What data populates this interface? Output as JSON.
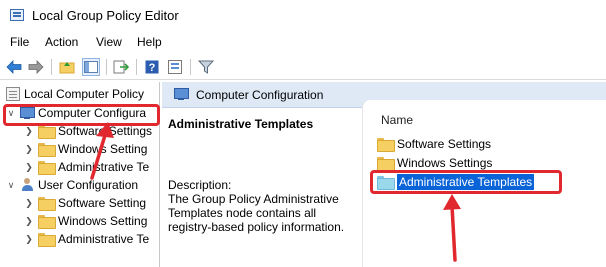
{
  "window": {
    "title": "Local Group Policy Editor",
    "icon": "policy-editor-icon"
  },
  "menu": {
    "items": [
      "File",
      "Action",
      "View",
      "Help"
    ]
  },
  "toolbar": {
    "buttons": [
      "back-arrow-icon",
      "forward-arrow-icon",
      "up-folder-icon",
      "show-hide-tree-icon",
      "export-list-icon",
      "help-icon",
      "properties-icon",
      "filter-icon"
    ]
  },
  "tree": {
    "root": "Local Computer Policy",
    "computer_config": "Computer Configura",
    "computer_children": [
      "Software Settings",
      "Windows Setting",
      "Administrative Te"
    ],
    "user_config": "User Configuration",
    "user_children": [
      "Software Setting",
      "Windows Setting",
      "Administrative Te"
    ]
  },
  "right": {
    "header": "Computer Configuration",
    "extended_title": "Administrative Templates",
    "description_label": "Description:",
    "description": "The Group Policy Administrative Templates node contains all registry-based policy information.",
    "column_name": "Name",
    "items": [
      "Software Settings",
      "Windows Settings",
      "Administrative Templates"
    ],
    "selected_index": 2
  },
  "colors": {
    "highlight": "#0a64d8",
    "annotation_red": "#e0282e",
    "header_bg": "#dfe8f5"
  }
}
